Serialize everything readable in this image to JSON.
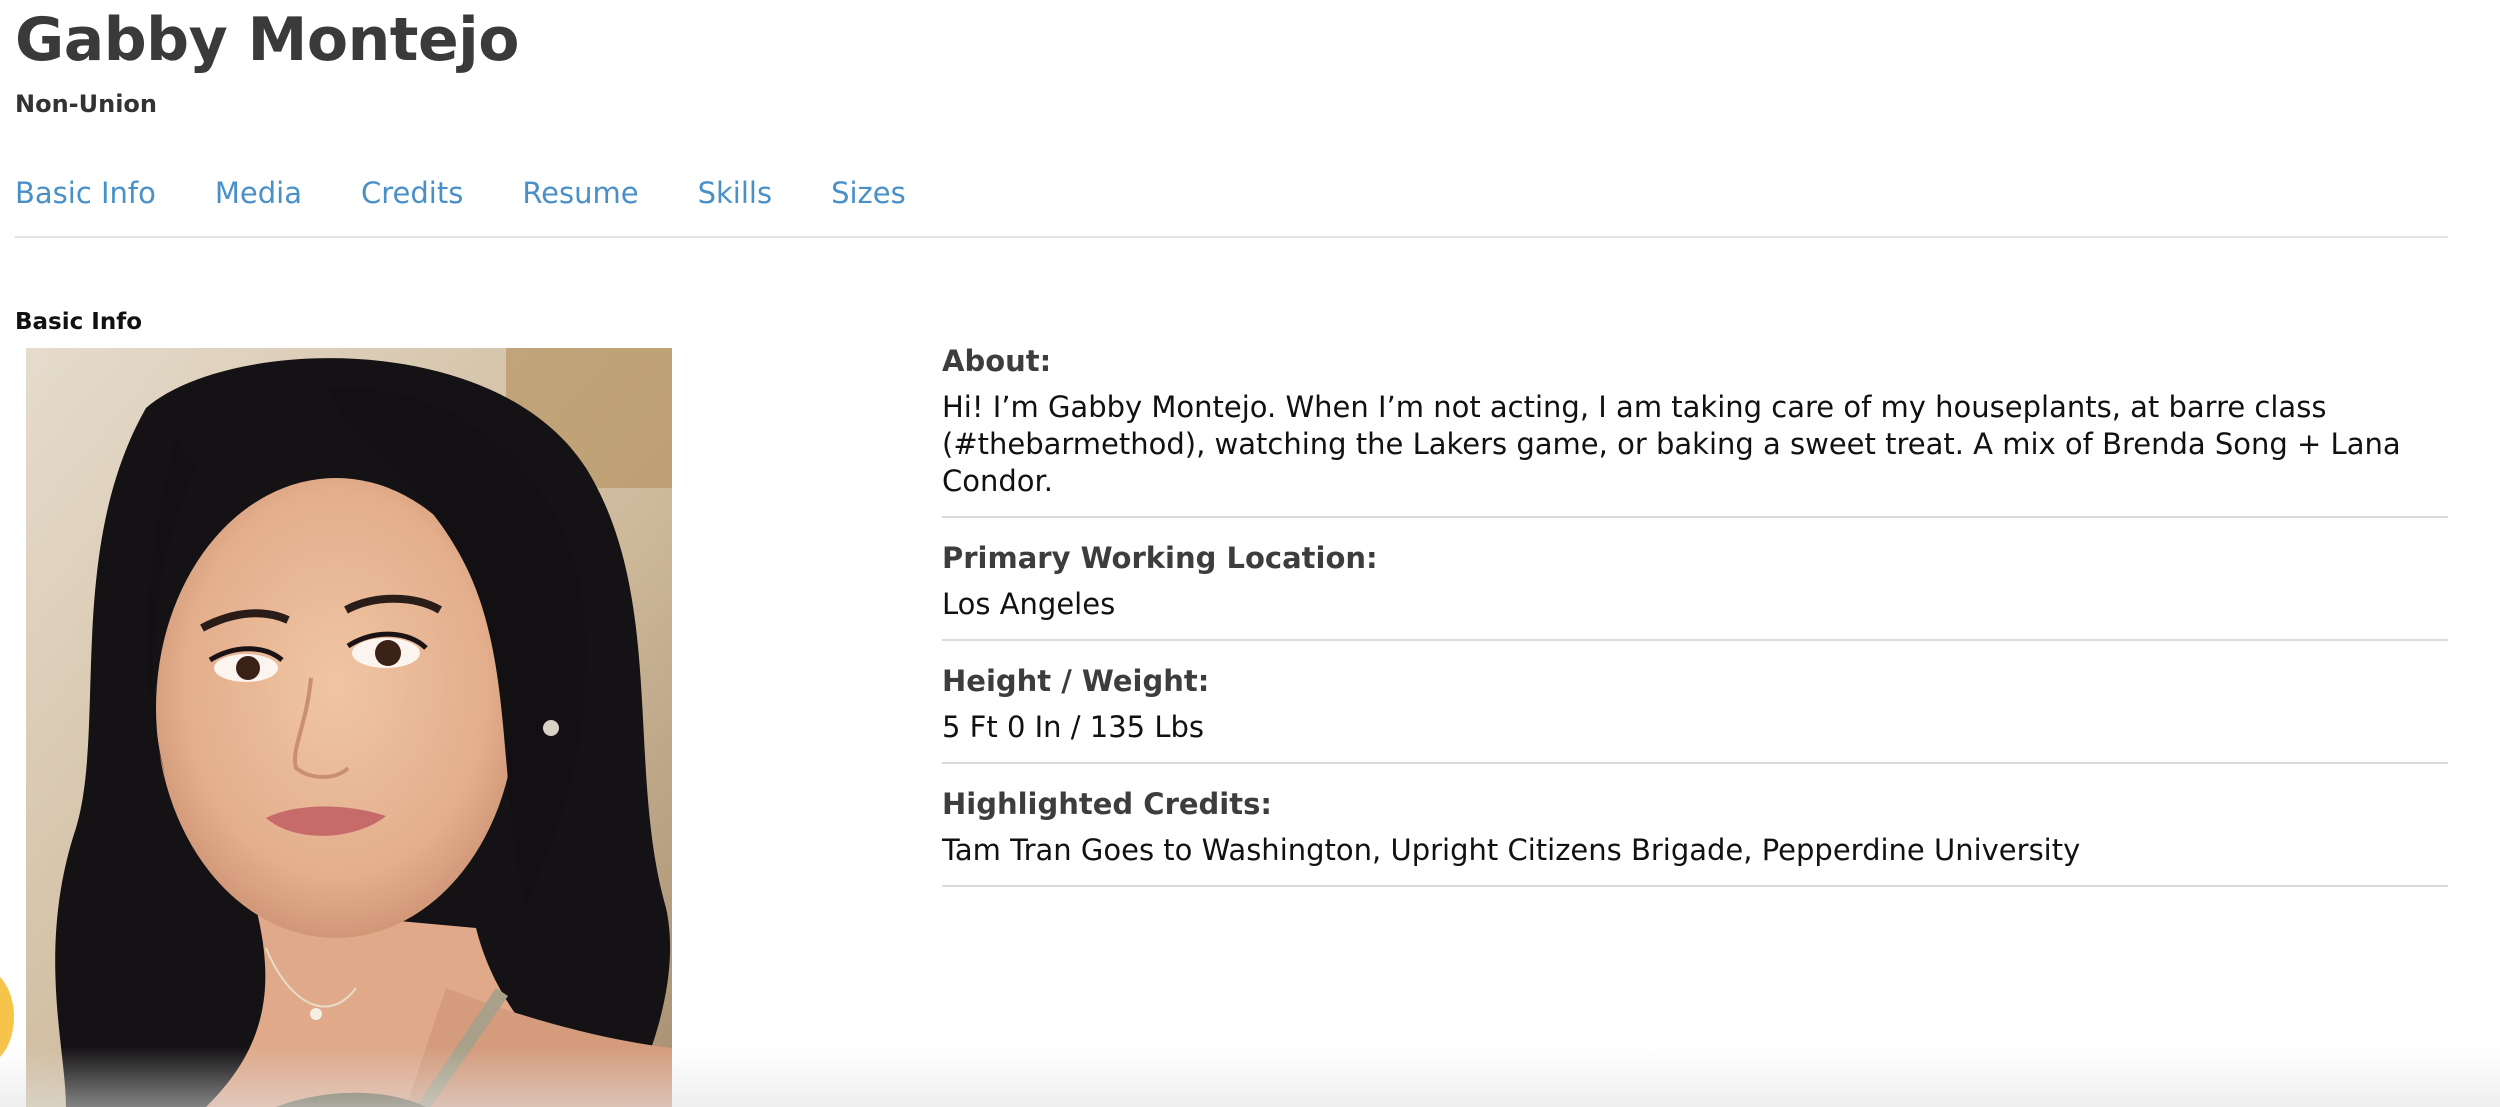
{
  "profile": {
    "name": "Gabby Montejo",
    "union_status": "Non-Union"
  },
  "tabs": [
    {
      "label": "Basic Info"
    },
    {
      "label": "Media"
    },
    {
      "label": "Credits"
    },
    {
      "label": "Resume"
    },
    {
      "label": "Skills"
    },
    {
      "label": "Sizes"
    }
  ],
  "basic_info": {
    "section_title": "Basic Info",
    "rows": [
      {
        "label": "About:",
        "value": "Hi! I’m Gabby Montejo. When I’m not acting, I am taking care of my houseplants, at barre class (#thebarmethod), watching the Lakers game, or baking a sweet treat. A mix of Brenda Song + Lana Condor."
      },
      {
        "label": "Primary Working Location:",
        "value": "Los Angeles"
      },
      {
        "label": "Height / Weight:",
        "value": "5 Ft 0 In / 135 Lbs"
      },
      {
        "label": "Highlighted Credits:",
        "value": "Tam Tran Goes to Washington, Upright Citizens Brigade, Pepperdine University"
      }
    ]
  },
  "colors": {
    "tab_link": "#4a90c8",
    "divider": "#dadada",
    "heading": "#3a3a3a",
    "fab_accent": "#f6c44a"
  },
  "icons": {
    "headshot": "headshot-photo",
    "floating_button": "floating-action-button"
  }
}
